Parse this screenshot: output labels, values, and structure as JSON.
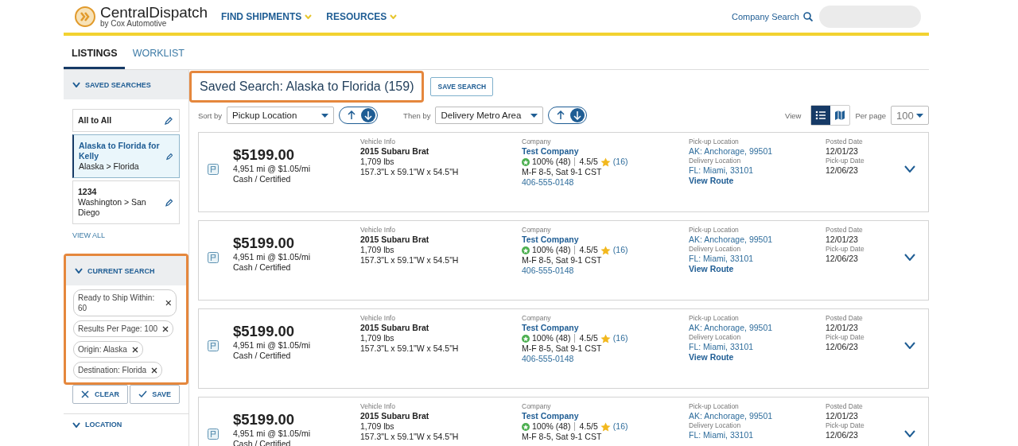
{
  "header": {
    "logo": {
      "name": "CentralDispatch",
      "tagline": "by Cox Automotive"
    },
    "nav": [
      {
        "label": "FIND SHIPMENTS"
      },
      {
        "label": "RESOURCES"
      }
    ],
    "company_search": "Company Search"
  },
  "tabs": [
    {
      "label": "LISTINGS",
      "selected": true
    },
    {
      "label": "WORKLIST",
      "selected": false
    }
  ],
  "sidebar": {
    "saved_searches": {
      "title": "SAVED SEARCHES",
      "items": [
        {
          "title": "All to All",
          "selected": false
        },
        {
          "title": "Alaska to Florida for Kelly",
          "route": "Alaska > Florida",
          "selected": true
        },
        {
          "title": "1234",
          "route": "Washington > San Diego",
          "selected": false
        }
      ],
      "view_all": "VIEW ALL"
    },
    "current_search": {
      "title": "CURRENT SEARCH",
      "highlighted": true,
      "chips": [
        "Ready to Ship Within: 60",
        "Results Per Page: 100",
        "Origin: Alaska",
        "Destination: Florida"
      ],
      "buttons": [
        {
          "kind": "clear",
          "label": "CLEAR"
        },
        {
          "kind": "save",
          "label": "SAVE"
        }
      ]
    },
    "location": {
      "title": "LOCATION"
    }
  },
  "main": {
    "title": "Saved Search: Alaska to Florida (159)",
    "title_highlighted": true,
    "save_button": "SAVE SEARCH",
    "sorts": [
      {
        "label": "Sort by",
        "value": "Pickup Location",
        "descending": true
      },
      {
        "label": "Then by",
        "value": "Delivery Metro Area",
        "descending": true
      }
    ],
    "view": {
      "label": "View",
      "modes": [
        {
          "kind": "list",
          "selected": true
        },
        {
          "kind": "map",
          "selected": false
        }
      ]
    },
    "per_page": {
      "label": "Per page",
      "value": "100"
    },
    "listings": [
      {
        "price": "$5199.00",
        "distance": "4,951 mi @ $1.05/mi",
        "payment": "Cash / Certified",
        "vehicle_label": "Vehicle Info",
        "vehicle": "2015 Subaru Brat",
        "weight": "1,709 lbs",
        "dimensions": "157.3\"L x 59.1\"W x 54.5\"H",
        "company_label": "Company",
        "company": "Test Company",
        "rating": "100% (48)",
        "score": "4.5/5",
        "reviews": "(16)",
        "hours": "M-F 8-5, Sat 9-1 CST",
        "phone": "406-555-0148",
        "pickup_label": "Pick-up Location",
        "pickup": "AK: Anchorage, 99501",
        "delivery_label": "Delivery Location",
        "delivery": "FL: Miami, 33101",
        "view_route": "View Route",
        "posted_label": "Posted Date",
        "posted": "12/01/23",
        "pickup_date_label": "Pick-up Date",
        "pickup_date": "12/06/23"
      },
      {
        "price": "$5199.00",
        "distance": "4,951 mi @ $1.05/mi",
        "payment": "Cash / Certified",
        "vehicle_label": "Vehicle Info",
        "vehicle": "2015 Subaru Brat",
        "weight": "1,709 lbs",
        "dimensions": "157.3\"L x 59.1\"W x 54.5\"H",
        "company_label": "Company",
        "company": "Test Company",
        "rating": "100% (48)",
        "score": "4.5/5",
        "reviews": "(16)",
        "hours": "M-F 8-5, Sat 9-1 CST",
        "phone": "406-555-0148",
        "pickup_label": "Pick-up Location",
        "pickup": "AK: Anchorage, 99501",
        "delivery_label": "Delivery Location",
        "delivery": "FL: Miami, 33101",
        "view_route": "View Route",
        "posted_label": "Posted Date",
        "posted": "12/01/23",
        "pickup_date_label": "Pick-up Date",
        "pickup_date": "12/06/23"
      },
      {
        "price": "$5199.00",
        "distance": "4,951 mi @ $1.05/mi",
        "payment": "Cash / Certified",
        "vehicle_label": "Vehicle Info",
        "vehicle": "2015 Subaru Brat",
        "weight": "1,709 lbs",
        "dimensions": "157.3\"L x 59.1\"W x 54.5\"H",
        "company_label": "Company",
        "company": "Test Company",
        "rating": "100% (48)",
        "score": "4.5/5",
        "reviews": "(16)",
        "hours": "M-F 8-5, Sat 9-1 CST",
        "phone": "406-555-0148",
        "pickup_label": "Pick-up Location",
        "pickup": "AK: Anchorage, 99501",
        "delivery_label": "Delivery Location",
        "delivery": "FL: Miami, 33101",
        "view_route": "View Route",
        "posted_label": "Posted Date",
        "posted": "12/01/23",
        "pickup_date_label": "Pick-up Date",
        "pickup_date": "12/06/23"
      },
      {
        "price": "$5199.00",
        "distance": "4,951 mi @ $1.05/mi",
        "payment": "Cash / Certified",
        "vehicle_label": "Vehicle Info",
        "vehicle": "2015 Subaru Brat",
        "weight": "1,709 lbs",
        "dimensions": "157.3\"L x 59.1\"W x 54.5\"H",
        "company_label": "Company",
        "company": "Test Company",
        "rating": "100% (48)",
        "score": "4.5/5",
        "reviews": "(16)",
        "hours": "M-F 8-5, Sat 9-1 CST",
        "pickup_label": "Pick-up Location",
        "pickup": "AK: Anchorage, 99501",
        "delivery_label": "Delivery Location",
        "delivery": "FL: Miami, 33101",
        "posted_label": "Posted Date",
        "posted": "12/01/23",
        "pickup_date_label": "Pick-up Date",
        "pickup_date": "12/06/23"
      }
    ]
  }
}
